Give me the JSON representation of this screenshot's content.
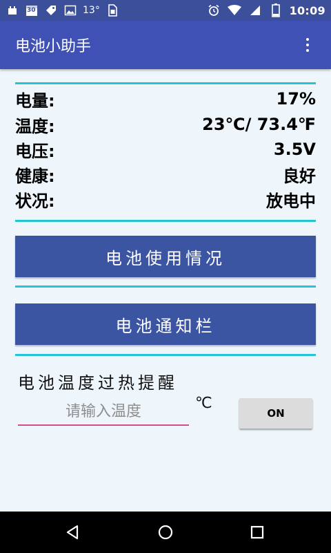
{
  "status_bar": {
    "calendar_day": "30",
    "temperature": "13°",
    "time": "10:09",
    "icons": [
      "usb-icon",
      "calendar-icon",
      "tag-icon",
      "image-icon",
      "sim-card-icon",
      "alarm-icon",
      "wifi-icon",
      "signal-icon",
      "battery-icon"
    ]
  },
  "toolbar": {
    "title": "电池小助手",
    "menu_icon": "more-vert-icon"
  },
  "battery_info": [
    {
      "label": "电量:",
      "value": "17%"
    },
    {
      "label": "温度:",
      "value": "23℃/ 73.4℉"
    },
    {
      "label": "电压:",
      "value": "3.5V"
    },
    {
      "label": "健康:",
      "value": "良好"
    },
    {
      "label": "状况:",
      "value": "放电中"
    }
  ],
  "buttons": {
    "usage": "电池使用情况",
    "notification": "电池通知栏"
  },
  "overheat": {
    "label": "电池温度过热提醒",
    "input_value": "",
    "input_placeholder": "请输入温度",
    "unit": "℃",
    "toggle_label": "ON"
  },
  "navigation": {
    "icons": [
      "back-icon",
      "home-icon",
      "recents-icon"
    ]
  },
  "colors": {
    "status_bar": "#3c4f9b",
    "toolbar": "#3f51b5",
    "accent_divider": "#25c3d6",
    "button": "#3c55a3",
    "input_underline": "#d24d8a",
    "background": "#eef6fb"
  }
}
